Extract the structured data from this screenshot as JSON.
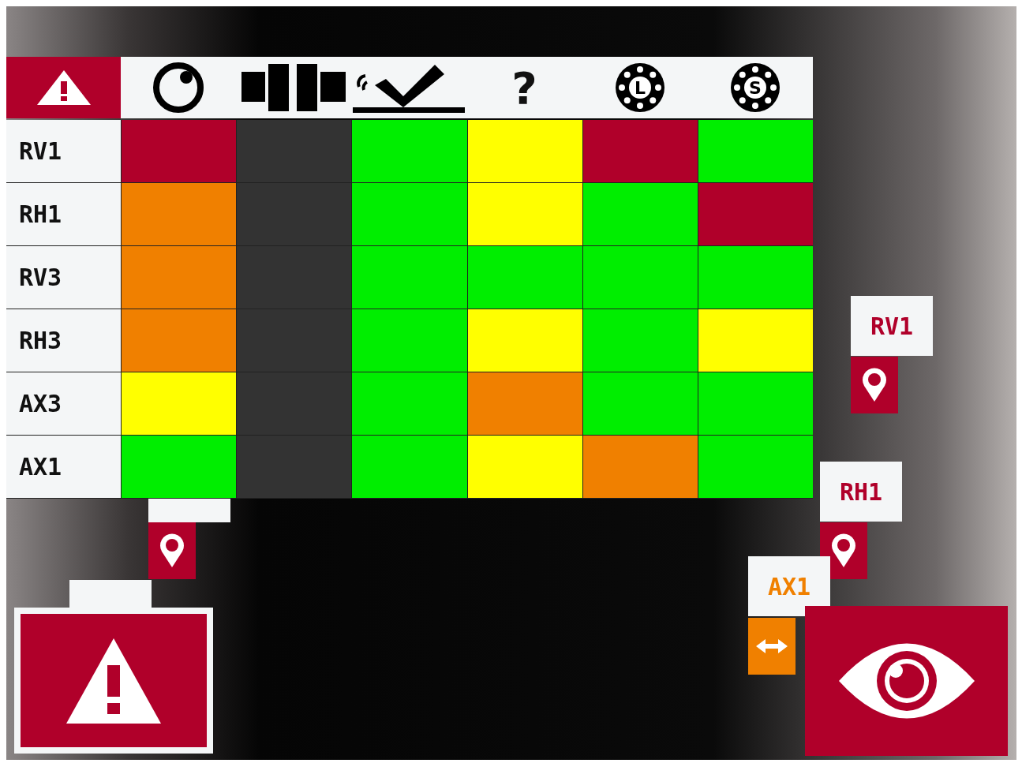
{
  "header": [
    {
      "kind": "alert",
      "selected": true
    },
    {
      "kind": "dial",
      "selected": false
    },
    {
      "kind": "coupling",
      "selected": false
    },
    {
      "kind": "surface-check",
      "selected": false
    },
    {
      "kind": "char",
      "text": "?",
      "selected": false
    },
    {
      "kind": "bearing",
      "text": "L",
      "selected": false
    },
    {
      "kind": "bearing",
      "text": "S",
      "selected": false
    }
  ],
  "rows": [
    {
      "name": "RV1",
      "cells": [
        {
          "color": "#b0002a"
        },
        {
          "color": "#333333"
        },
        {
          "color": "#00ee00"
        },
        {
          "color": "#ffff00"
        },
        {
          "color": "#b0002a"
        },
        {
          "color": "#00ee00"
        }
      ]
    },
    {
      "name": "RH1",
      "cells": [
        {
          "color": "#f08000"
        },
        {
          "color": "#333333"
        },
        {
          "color": "#00ee00"
        },
        {
          "color": "#ffff00"
        },
        {
          "color": "#00ee00"
        },
        {
          "color": "#b0002a"
        }
      ]
    },
    {
      "name": "RV3",
      "cells": [
        {
          "color": "#f08000"
        },
        {
          "color": "#333333"
        },
        {
          "color": "#00ee00"
        },
        {
          "color": "#00ee00"
        },
        {
          "color": "#00ee00"
        },
        {
          "color": "#00ee00"
        }
      ]
    },
    {
      "name": "RH3",
      "cells": [
        {
          "color": "#f08000"
        },
        {
          "color": "#333333"
        },
        {
          "color": "#00ee00"
        },
        {
          "color": "#ffff00"
        },
        {
          "color": "#00ee00"
        },
        {
          "color": "#ffff00"
        }
      ]
    },
    {
      "name": "AX3",
      "cells": [
        {
          "color": "#ffff00"
        },
        {
          "color": "#333333"
        },
        {
          "color": "#00ee00"
        },
        {
          "color": "#f08000"
        },
        {
          "color": "#00ee00"
        },
        {
          "color": "#00ee00"
        }
      ]
    },
    {
      "name": "AX1",
      "cells": [
        {
          "color": "#00ee00"
        },
        {
          "color": "#333333"
        },
        {
          "color": "#00ee00"
        },
        {
          "color": "#ffff00"
        },
        {
          "color": "#f08000"
        },
        {
          "color": "#00ee00"
        }
      ]
    }
  ],
  "markers": [
    {
      "label": "RV1",
      "kind": "pin",
      "color": "#b0002a"
    },
    {
      "label": "RH1",
      "kind": "pin",
      "color": "#b0002a"
    },
    {
      "label": "AX1",
      "kind": "move",
      "color": "#f08000"
    },
    {
      "kind": "pin"
    },
    {
      "kind": "none"
    }
  ]
}
